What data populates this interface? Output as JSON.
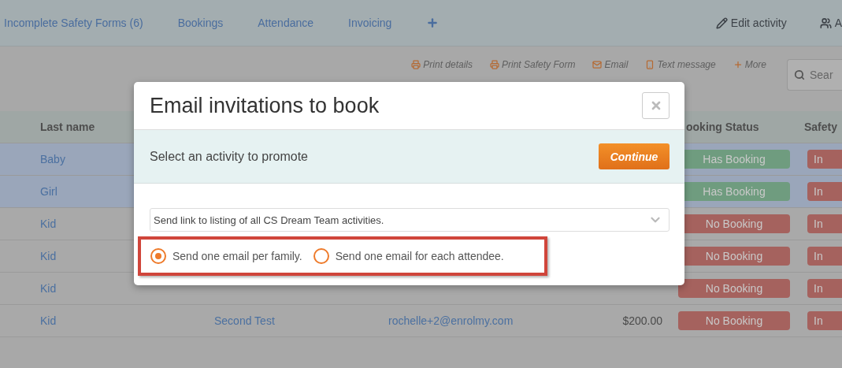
{
  "nav": {
    "tabs": [
      {
        "label": "Incomplete Safety Forms (6)",
        "selected": false
      },
      {
        "label": "Bookings",
        "selected": false
      },
      {
        "label": "Attendance",
        "selected": false
      },
      {
        "label": "Invoicing",
        "selected": false
      }
    ],
    "actions": [
      {
        "label": "Edit activity",
        "kind": "pencil"
      },
      {
        "label": "A",
        "kind": "users"
      }
    ]
  },
  "toolbar": {
    "actions": [
      {
        "label": "Print details",
        "kind": "printer"
      },
      {
        "label": "Print Safety Form",
        "kind": "printer"
      },
      {
        "label": "Email",
        "kind": "mail"
      },
      {
        "label": "Text message",
        "kind": "phone"
      },
      {
        "label": "More",
        "kind": "plus"
      }
    ],
    "search": {
      "placeholder": "Sear"
    }
  },
  "table": {
    "header": {
      "last_name": "Last name",
      "booking_status": "ooking Status",
      "safety": "Safety"
    },
    "rows": [
      {
        "selected": true,
        "last_name": "Baby",
        "booking": {
          "label": "Has Booking",
          "color": "#6f9c7f"
        },
        "safety": {
          "label": "In",
          "color": "#a5625e"
        }
      },
      {
        "selected": true,
        "last_name": "Girl",
        "booking": {
          "label": "Has Booking",
          "color": "#6f9c7f"
        },
        "safety": {
          "label": "In",
          "color": "#a5625e"
        }
      },
      {
        "selected": false,
        "last_name": "Kid",
        "booking": {
          "label": "No Booking",
          "color": "#a5625e"
        },
        "safety": {
          "label": "In",
          "color": "#a5625e"
        }
      },
      {
        "selected": false,
        "last_name": "Kid",
        "booking": {
          "label": "No Booking",
          "color": "#a5625e"
        },
        "safety": {
          "label": "In",
          "color": "#a5625e"
        }
      },
      {
        "selected": false,
        "last_name": "Kid",
        "booking": {
          "label": "No Booking",
          "color": "#a5625e"
        },
        "safety": {
          "label": "In",
          "color": "#a5625e"
        }
      },
      {
        "selected": false,
        "last_name": "Kid",
        "activity": "Second Test",
        "email": "rochelle+2@enrolmy.com",
        "price": "$200.00",
        "booking": {
          "label": "No Booking",
          "color": "#a5625e"
        },
        "safety": {
          "label": "In",
          "color": "#a5625e"
        }
      }
    ]
  },
  "modal": {
    "title": "Email invitations to book",
    "prompt": "Select an activity to promote",
    "continue": "Continue",
    "select": {
      "value": "Send link to listing of all CS Dream Team activities."
    },
    "options": [
      {
        "label": "Send one email per family.",
        "selected": true
      },
      {
        "label": "Send one email for each attendee.",
        "selected": false
      }
    ]
  }
}
